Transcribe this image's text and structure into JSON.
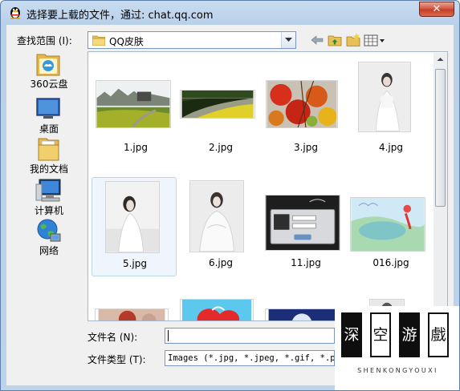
{
  "window": {
    "title": "选择要上载的文件，通过: chat.qq.com",
    "close_label": "✕"
  },
  "toolbar": {
    "lookin_label": "查找范围 (I):",
    "lookin_value": "QQ皮肤"
  },
  "places": [
    {
      "label": "360云盘",
      "icon": "cloud-drive-icon"
    },
    {
      "label": "桌面",
      "icon": "desktop-icon"
    },
    {
      "label": "我的文档",
      "icon": "documents-folder-icon"
    },
    {
      "label": "计算机",
      "icon": "computer-icon"
    },
    {
      "label": "网络",
      "icon": "network-icon"
    }
  ],
  "files": [
    {
      "name": "1.jpg",
      "selected": false
    },
    {
      "name": "2.jpg",
      "selected": false
    },
    {
      "name": "3.jpg",
      "selected": false
    },
    {
      "name": "4.jpg",
      "selected": false
    },
    {
      "name": "5.jpg",
      "selected": true
    },
    {
      "name": "6.jpg",
      "selected": false
    },
    {
      "name": "11.jpg",
      "selected": false
    },
    {
      "name": "016.jpg",
      "selected": false
    }
  ],
  "footer": {
    "filename_label": "文件名 (N):",
    "filename_value": "",
    "filetype_label": "文件类型 (T):",
    "filetype_value": "Images (*.jpg, *.jpeg, *.gif, *.png)"
  },
  "watermark": {
    "chars": [
      "深",
      "空",
      "游",
      "戲"
    ],
    "subtitle": "SHENKONGYOUXI"
  },
  "colors": {
    "title_bar": "#b9d0ea",
    "close_button": "#c43b22",
    "selection": "#eef5fc"
  }
}
